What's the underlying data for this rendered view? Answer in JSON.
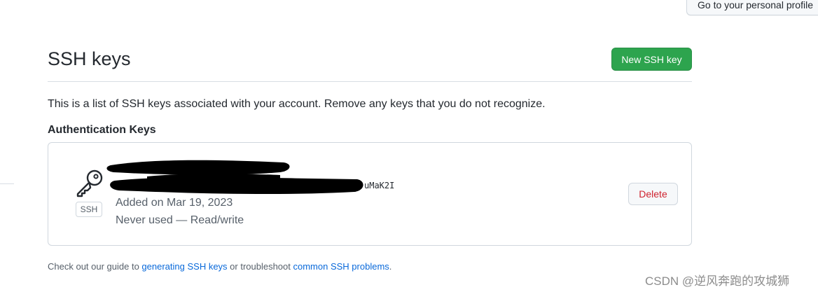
{
  "header": {
    "profile_button_label": "Go to your personal profile"
  },
  "page": {
    "title": "SSH keys",
    "new_key_button_label": "New SSH key",
    "description": "This is a list of SSH keys associated with your account. Remove any keys that you do not recognize."
  },
  "authentication_keys": {
    "heading": "Authentication Keys",
    "keys": [
      {
        "type_label": "SSH",
        "fingerprint_line1": "",
        "fingerprint_line2": "uMaK2I",
        "added_on": "Added on Mar 19, 2023",
        "usage": "Never used — Read/write",
        "delete_label": "Delete"
      }
    ]
  },
  "footer": {
    "prefix": "Check out our guide to ",
    "link1": "generating SSH keys",
    "middle": " or troubleshoot ",
    "link2": "common SSH problems",
    "suffix": "."
  },
  "watermark": "CSDN @逆风奔跑的攻城狮",
  "colors": {
    "primary_button": "#2da44e",
    "danger_text": "#cf222e",
    "link": "#0969da",
    "border": "#d0d7de"
  },
  "icons": {
    "key": "key-icon"
  }
}
